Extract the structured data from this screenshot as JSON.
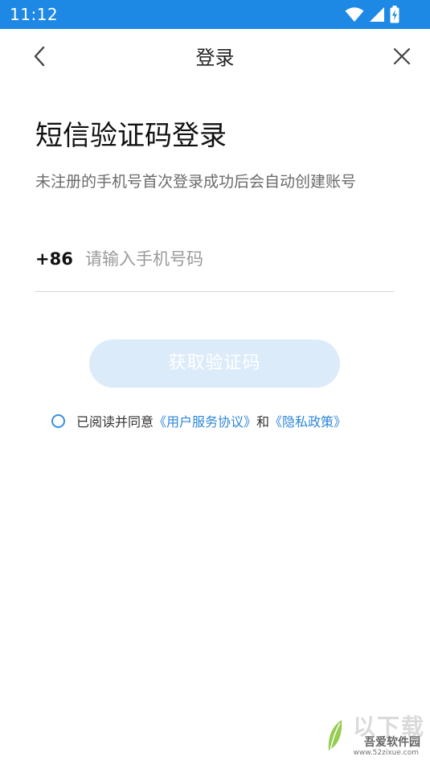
{
  "status_bar": {
    "time": "11:12",
    "icons": [
      "wifi-icon",
      "cellular-signal-icon",
      "battery-charging-icon"
    ]
  },
  "header": {
    "title": "登录",
    "back_icon": "chevron-left-icon",
    "close_icon": "close-icon"
  },
  "main": {
    "heading": "短信验证码登录",
    "subtitle": "未注册的手机号首次登录成功后会自动创建账号",
    "phone": {
      "country_code": "+86",
      "value": "",
      "placeholder": "请输入手机号码"
    },
    "get_code_button": "获取验证码",
    "agreement": {
      "checked": false,
      "prefix": "已阅读并同意",
      "user_agreement": "《用户服务协议》",
      "conjunction": "和",
      "privacy_policy": "《隐私政策》"
    }
  },
  "watermark": {
    "name": "吾爱软件园",
    "url": "www.52zixue.com"
  },
  "colors": {
    "status_bar": "#1e88e5",
    "link": "#2f87d8",
    "button_disabled": "#dcebfa",
    "radio_border": "#3b8fe0"
  }
}
